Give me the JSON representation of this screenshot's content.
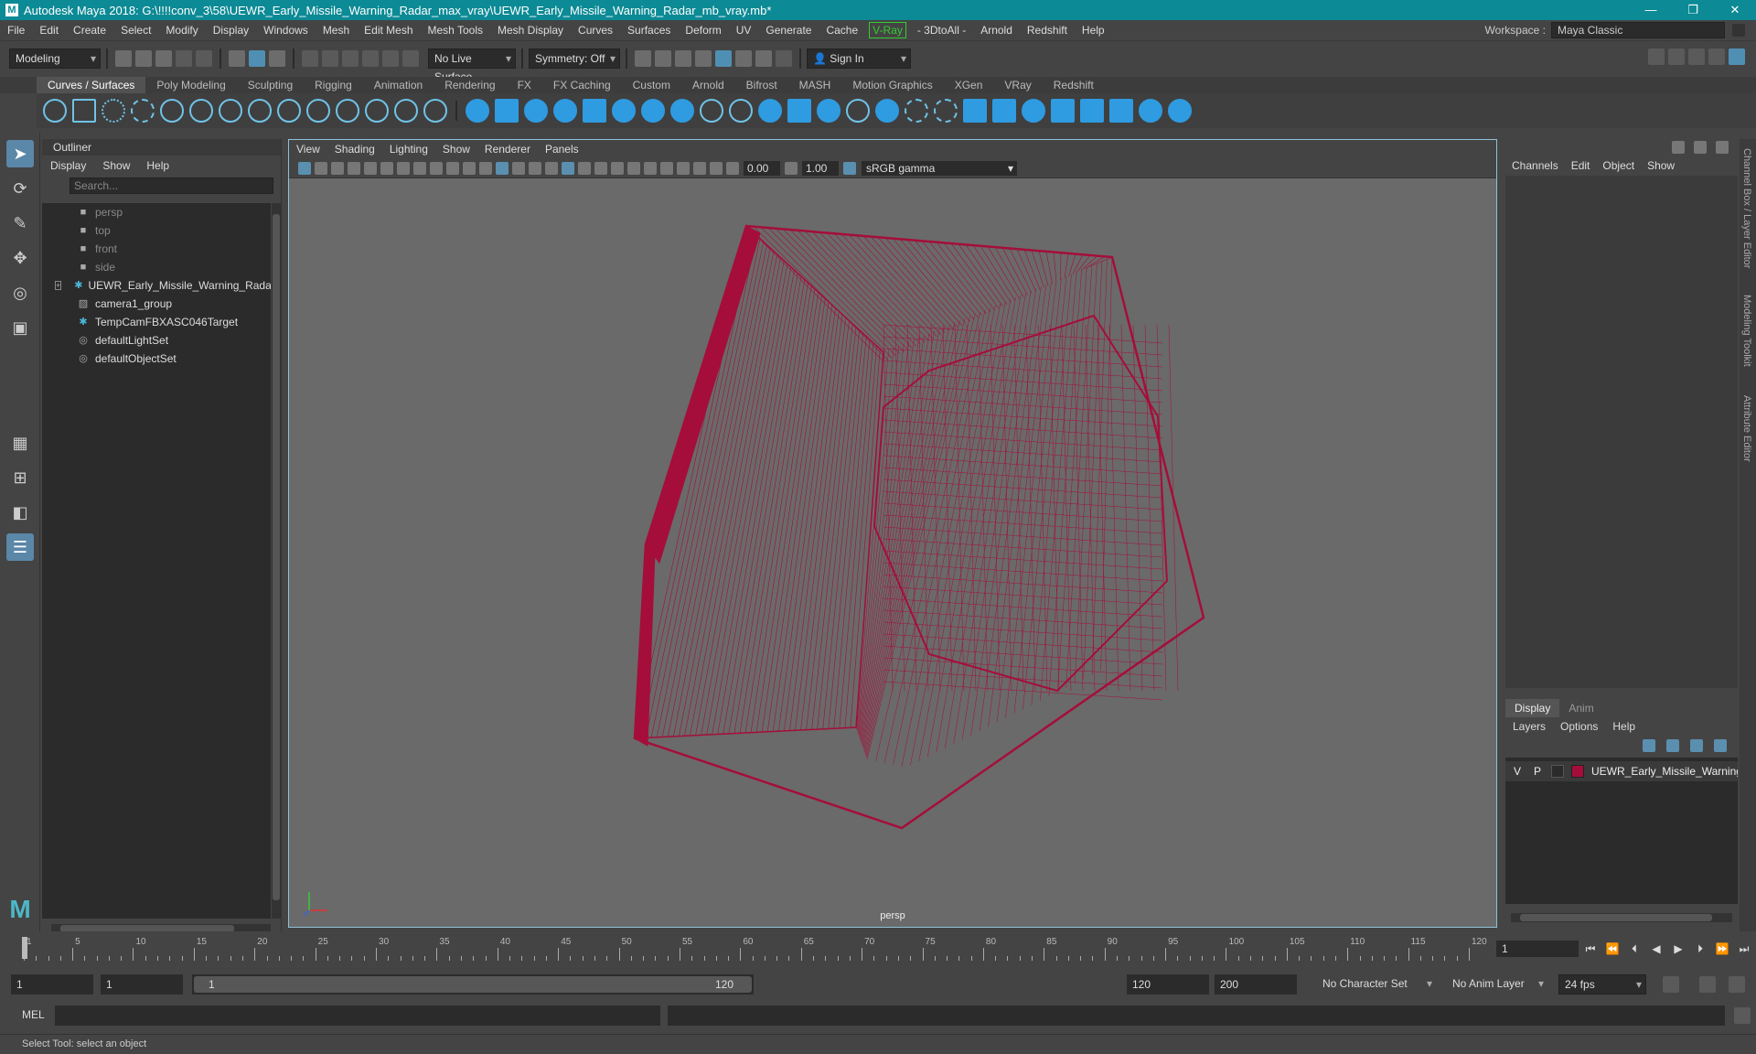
{
  "titlebar": {
    "title": "Autodesk Maya 2018: G:\\!!!!conv_3\\58\\UEWR_Early_Missile_Warning_Radar_max_vray\\UEWR_Early_Missile_Warning_Radar_mb_vray.mb*",
    "logo": "M",
    "buttons": [
      "—",
      "❐",
      "✕"
    ]
  },
  "menubar": {
    "items": [
      "File",
      "Edit",
      "Create",
      "Select",
      "Modify",
      "Display",
      "Windows",
      "Mesh",
      "Edit Mesh",
      "Mesh Tools",
      "Mesh Display",
      "Curves",
      "Surfaces",
      "Deform",
      "UV",
      "Generate",
      "Cache"
    ],
    "vray": "V-Ray",
    "items2": [
      "- 3DtoAll -",
      "Arnold",
      "Redshift",
      "Help"
    ],
    "workspace_label": "Workspace :",
    "workspace_value": "Maya Classic"
  },
  "statusline": {
    "mode": "Modeling",
    "live_surface": "No Live Surface",
    "symmetry": "Symmetry: Off",
    "sign_in": "Sign In"
  },
  "shelf": {
    "tabs": [
      "Curves / Surfaces",
      "Poly Modeling",
      "Sculpting",
      "Rigging",
      "Animation",
      "Rendering",
      "FX",
      "FX Caching",
      "Custom",
      "Arnold",
      "Bifrost",
      "MASH",
      "Motion Graphics",
      "XGen",
      "VRay",
      "Redshift"
    ],
    "active_tab": "Curves / Surfaces"
  },
  "outliner": {
    "title": "Outliner",
    "menu": [
      "Display",
      "Show",
      "Help"
    ],
    "search_placeholder": "Search...",
    "items": [
      {
        "name": "persp",
        "icon": "camera-icon",
        "dim": true
      },
      {
        "name": "top",
        "icon": "camera-icon",
        "dim": true
      },
      {
        "name": "front",
        "icon": "camera-icon",
        "dim": true
      },
      {
        "name": "side",
        "icon": "camera-icon",
        "dim": true
      },
      {
        "name": "UEWR_Early_Missile_Warning_Radar_",
        "icon": "transform-icon",
        "dim": false,
        "expandable": true
      },
      {
        "name": "camera1_group",
        "icon": "group-icon",
        "dim": false
      },
      {
        "name": "TempCamFBXASC046Target",
        "icon": "transform-icon",
        "dim": false
      },
      {
        "name": "defaultLightSet",
        "icon": "set-icon",
        "dim": false
      },
      {
        "name": "defaultObjectSet",
        "icon": "set-icon",
        "dim": false
      }
    ]
  },
  "viewport": {
    "menu": [
      "View",
      "Shading",
      "Lighting",
      "Show",
      "Renderer",
      "Panels"
    ],
    "exposure": "0.00",
    "gamma": "1.00",
    "color_space": "sRGB gamma",
    "camera": "persp",
    "wire_color": "#a50e3a"
  },
  "channelbox": {
    "tabs": [
      "Channels",
      "Edit",
      "Object",
      "Show"
    ]
  },
  "layers": {
    "tabs": [
      "Display",
      "Anim"
    ],
    "active_tab": "Display",
    "menu": [
      "Layers",
      "Options",
      "Help"
    ],
    "rows": [
      {
        "v": "V",
        "p": "P",
        "name": "UEWR_Early_Missile_Warning_",
        "color": "#a50e3a"
      }
    ]
  },
  "sidetabs": [
    "Channel Box / Layer Editor",
    "Modeling Toolkit",
    "Attribute Editor"
  ],
  "timeslider": {
    "ticks": [
      1,
      5,
      10,
      15,
      20,
      25,
      30,
      35,
      40,
      45,
      50,
      55,
      60,
      65,
      70,
      75,
      80,
      85,
      90,
      95,
      100,
      105,
      110,
      115,
      120
    ],
    "current_frame": "1",
    "range_end": 120
  },
  "rangeslider": {
    "start": "1",
    "playback_start": "1",
    "range_start_label": "1",
    "range_end_label": "120",
    "playback_end": "120",
    "end": "200",
    "character_set": "No Character Set",
    "anim_layer": "No Anim Layer",
    "fps": "24 fps"
  },
  "cmdline": {
    "label": "MEL"
  },
  "helpline": {
    "text": "Select Tool: select an object"
  }
}
